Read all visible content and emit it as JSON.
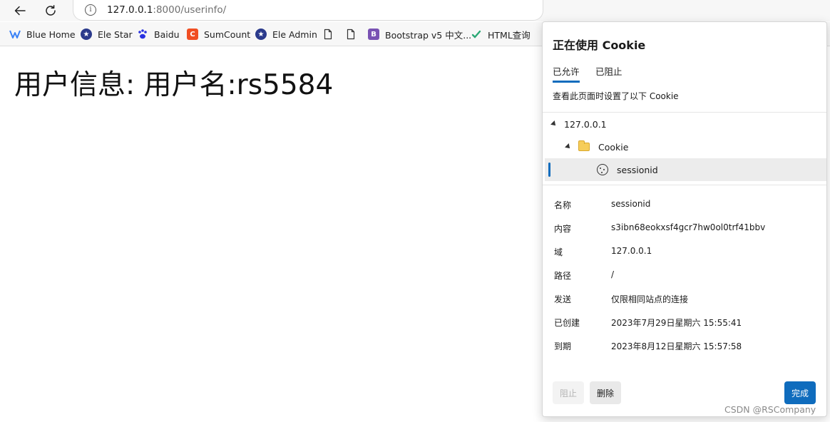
{
  "browser": {
    "url_host": "127.0.0.1",
    "url_path": ":8000/userinfo/",
    "bookmarks": [
      {
        "label": "Blue Home",
        "icon": "blue-home-icon",
        "color": "#3b82f6"
      },
      {
        "label": "Ele Star",
        "icon": "ele-star-icon",
        "color": "#2b3a8c"
      },
      {
        "label": "Baidu",
        "icon": "baidu-paw-icon",
        "color": "#2932e1"
      },
      {
        "label": "SumCount",
        "icon": "sumcount-icon",
        "color": "#f04e23"
      },
      {
        "label": "Ele Admin",
        "icon": "ele-admin-icon",
        "color": "#2b3a8c"
      },
      {
        "label": "",
        "icon": "document-icon"
      },
      {
        "label": "",
        "icon": "document-icon"
      },
      {
        "label": "Bootstrap v5 中文...",
        "icon": "bootstrap-icon",
        "color": "#7952b3"
      },
      {
        "label": "HTML查询",
        "icon": "html-query-icon",
        "color": "#2ba875"
      }
    ]
  },
  "page": {
    "heading": "用户信息: 用户名:rs5584"
  },
  "cookie_panel": {
    "title": "正在使用 Cookie",
    "tabs": {
      "allowed": "已允许",
      "blocked": "已阻止"
    },
    "description": "查看此页面时设置了以下 Cookie",
    "tree": {
      "site": "127.0.0.1",
      "folder": "Cookie",
      "cookie": "sessionid"
    },
    "details": [
      {
        "label": "名称",
        "value": "sessionid"
      },
      {
        "label": "内容",
        "value": "s3ibn68eokxsf4gcr7hw0ol0trf41bbv"
      },
      {
        "label": "域",
        "value": "127.0.0.1"
      },
      {
        "label": "路径",
        "value": "/"
      },
      {
        "label": "发送",
        "value": "仅限相同站点的连接"
      },
      {
        "label": "已创建",
        "value": "2023年7月29日星期六 15:55:41"
      },
      {
        "label": "到期",
        "value": "2023年8月12日星期六 15:57:58"
      }
    ],
    "buttons": {
      "block": "阻止",
      "delete": "删除",
      "done": "完成"
    },
    "accent_color": "#0f6cbd"
  },
  "watermark": "CSDN @RSCompany"
}
